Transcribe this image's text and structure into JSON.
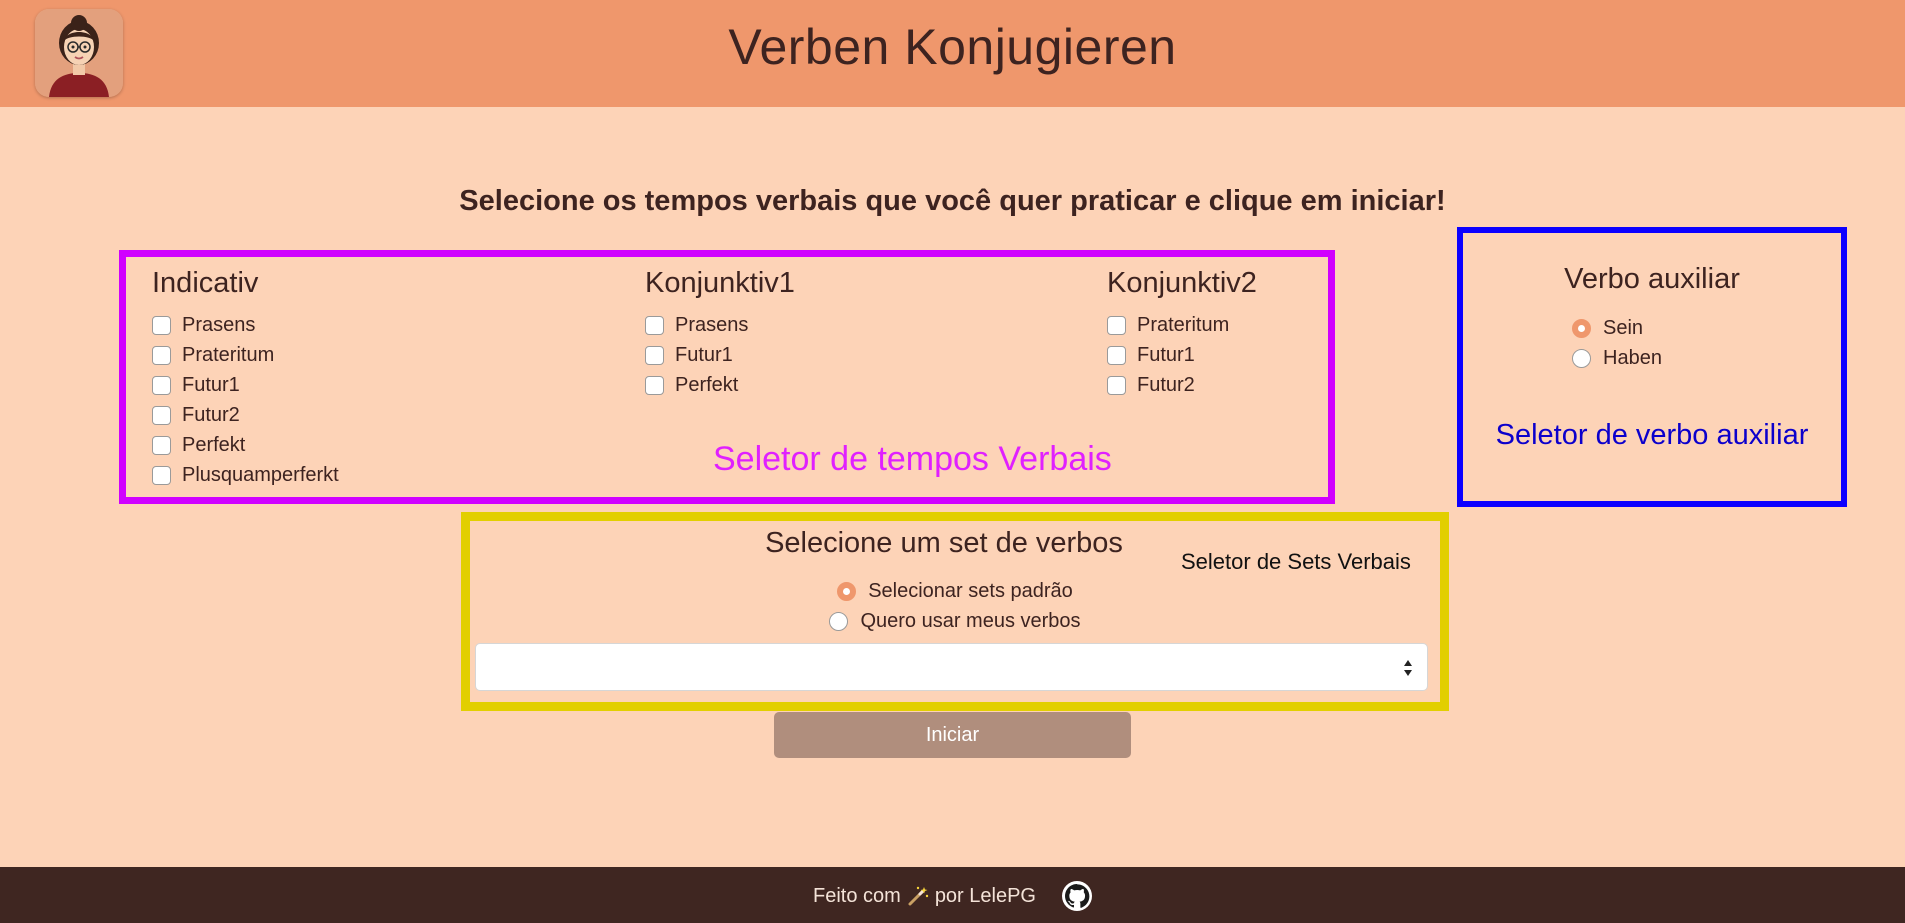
{
  "header": {
    "title": "Verben Konjugieren",
    "avatar_icon": "avatar-icon"
  },
  "instruction": "Selecione os tempos verbais que você quer praticar e clique em iniciar!",
  "tenses": {
    "caption": "Seletor de tempos Verbais",
    "columns": [
      {
        "title": "Indicativ",
        "options": [
          "Prasens",
          "Prateritum",
          "Futur1",
          "Futur2",
          "Perfekt",
          "Plusquamperferkt"
        ]
      },
      {
        "title": "Konjunktiv1",
        "options": [
          "Prasens",
          "Futur1",
          "Perfekt"
        ]
      },
      {
        "title": "Konjunktiv2",
        "options": [
          "Prateritum",
          "Futur1",
          "Futur2"
        ]
      }
    ]
  },
  "aux": {
    "title": "Verbo auxiliar",
    "options": [
      "Sein",
      "Haben"
    ],
    "selected": "Sein",
    "caption": "Seletor de verbo auxiliar"
  },
  "sets": {
    "title": "Selecione um set de verbos",
    "caption": "Seletor de Sets Verbais",
    "options": [
      "Selecionar sets padrão",
      "Quero usar meus verbos"
    ],
    "selected": "Selecionar sets padrão",
    "select_value": ""
  },
  "start_button": "Iniciar",
  "footer": {
    "text_before": "Feito com",
    "text_after": "por LelePG",
    "wand_icon": "magic-wand-icon",
    "github_icon": "github-icon"
  },
  "colors": {
    "header_bg": "#ef976c",
    "page_bg": "#fdd3b7",
    "footer_bg": "#3f2621",
    "magenta": "#d000ff",
    "blue": "#0c00ff",
    "yellow": "#e2cf00",
    "button_bg": "#b08e7d"
  }
}
